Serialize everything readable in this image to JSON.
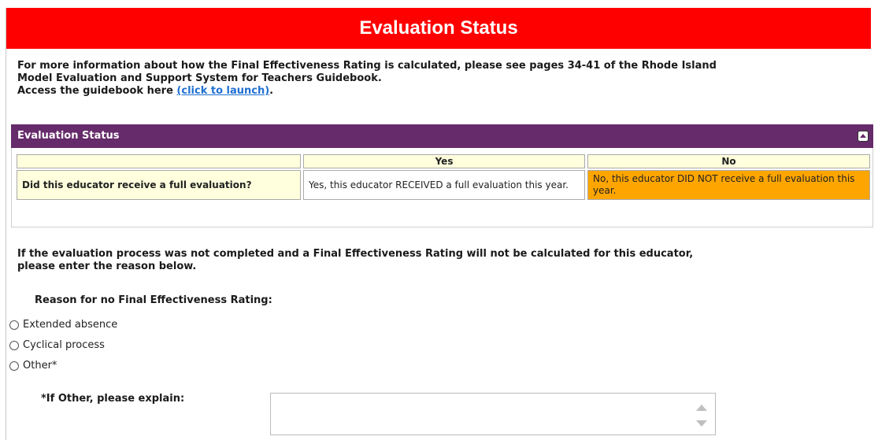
{
  "page": {
    "title": "Evaluation Status"
  },
  "intro": {
    "line1": "For more information about how the Final Effectiveness Rating is calculated, please see pages 34-41 of the Rhode Island",
    "line2": "Model Evaluation and Support System for Teachers Guidebook.",
    "access_prefix": "Access the guidebook here ",
    "link_text": "(click to launch)",
    "access_suffix": "."
  },
  "panel": {
    "title": "Evaluation Status",
    "columns": {
      "yes": "Yes",
      "no": "No"
    },
    "question": "Did this educator receive a full evaluation?",
    "yes_text": "Yes, this educator RECEIVED a full evaluation this year.",
    "no_text": "No, this educator DID NOT receive a full evaluation this year.",
    "selected": "no",
    "selected_color": "#ffa500"
  },
  "reason": {
    "intro_line1": "If the evaluation process was not completed and a Final Effectiveness Rating will not be calculated for this educator,",
    "intro_line2": "please enter the reason below.",
    "title": "Reason for no Final Effectiveness Rating:",
    "options": [
      "Extended absence",
      "Cyclical process",
      "Other*"
    ],
    "explain_label": "*If Other, please explain:",
    "explain_value": ""
  },
  "colors": {
    "banner": "#ff0000",
    "panel_header": "#662b6b",
    "cell_bg": "#ffffdd",
    "link": "#1f6fd1"
  }
}
